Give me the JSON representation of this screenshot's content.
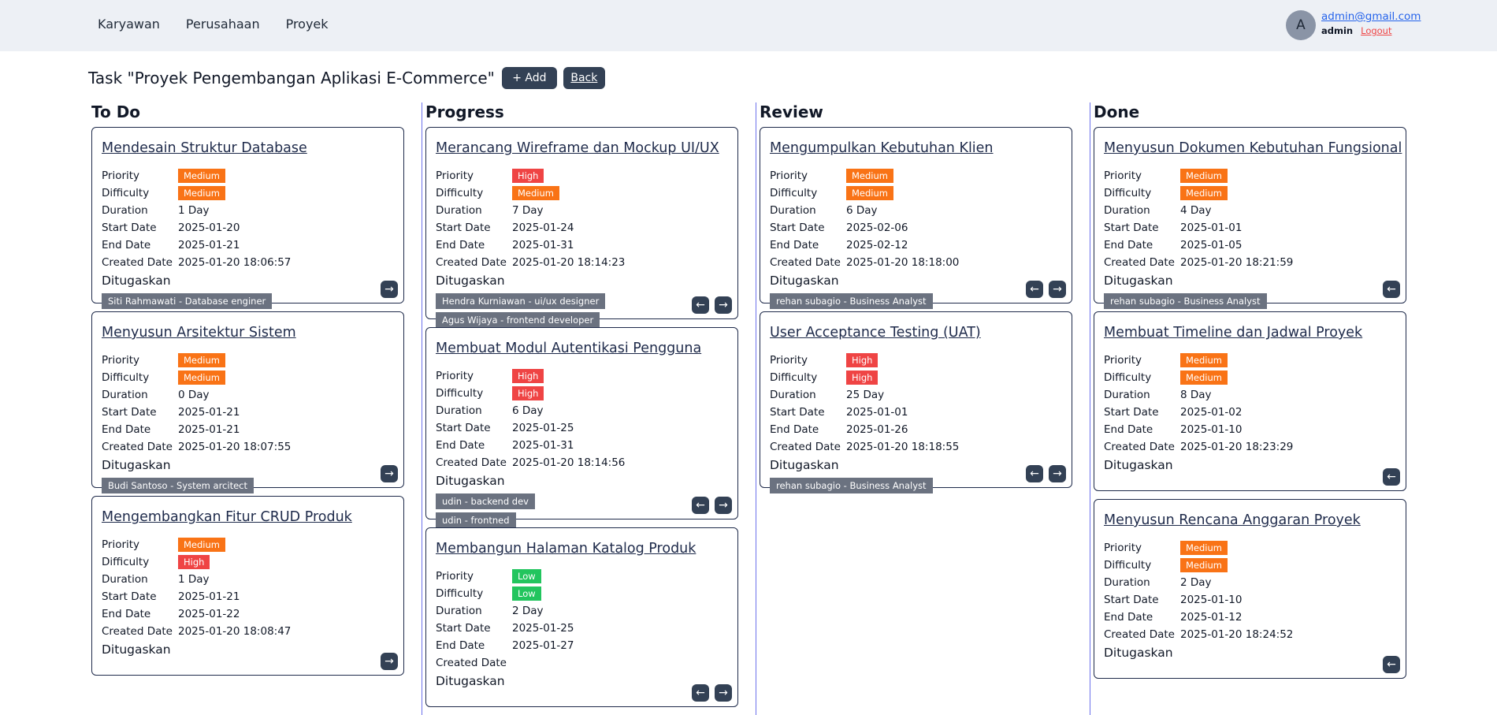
{
  "nav": {
    "links": [
      "Karyawan",
      "Perusahaan",
      "Proyek"
    ]
  },
  "user": {
    "avatar_letter": "A",
    "email": "admin@gmail.com",
    "role": "admin",
    "logout": "Logout"
  },
  "page": {
    "title": "Task \"Proyek Pengembangan Aplikasi E-Commerce\"",
    "add_label": "+ Add",
    "back_label": "Back"
  },
  "field_labels": {
    "priority": "Priority",
    "difficulty": "Difficulty",
    "duration": "Duration",
    "start": "Start Date",
    "end": "End Date",
    "created": "Created Date",
    "assigned": "Ditugaskan"
  },
  "icons": {
    "prev": "arrow-left-icon",
    "next": "arrow-right-icon"
  },
  "colors": {
    "medium": "#f97316",
    "high": "#ef4444",
    "low": "#22c55e",
    "chip": "#6b7280",
    "button": "#334155",
    "column_divider": "#6d72ec"
  },
  "columns": [
    {
      "title": "To Do",
      "cards": [
        {
          "title": "Mendesain Struktur Database",
          "priority": "Medium",
          "difficulty": "Medium",
          "duration": "1 Day",
          "start": "2025-01-20",
          "end": "2025-01-21",
          "created": "2025-01-20 18:06:57",
          "assignees": [
            "Siti Rahmawati - Database enginer"
          ],
          "prev": false,
          "next": true
        },
        {
          "title": "Menyusun Arsitektur Sistem",
          "priority": "Medium",
          "difficulty": "Medium",
          "duration": "0 Day",
          "start": "2025-01-21",
          "end": "2025-01-21",
          "created": "2025-01-20 18:07:55",
          "assignees": [
            "Budi Santoso - System arcitect"
          ],
          "prev": false,
          "next": true
        },
        {
          "title": "Mengembangkan Fitur CRUD Produk",
          "priority": "Medium",
          "difficulty": "High",
          "duration": "1 Day",
          "start": "2025-01-21",
          "end": "2025-01-22",
          "created": "2025-01-20 18:08:47",
          "assignees": [],
          "prev": false,
          "next": true
        }
      ]
    },
    {
      "title": "Progress",
      "cards": [
        {
          "title": "Merancang Wireframe dan Mockup UI/UX",
          "priority": "High",
          "difficulty": "Medium",
          "duration": "7 Day",
          "start": "2025-01-24",
          "end": "2025-01-31",
          "created": "2025-01-20 18:14:23",
          "assignees": [
            "Hendra Kurniawan - ui/ux designer",
            "Agus Wijaya - frontend developer"
          ],
          "prev": true,
          "next": true
        },
        {
          "title": "Membuat Modul Autentikasi Pengguna",
          "priority": "High",
          "difficulty": "High",
          "duration": "6 Day",
          "start": "2025-01-25",
          "end": "2025-01-31",
          "created": "2025-01-20 18:14:56",
          "assignees": [
            "udin - backend dev",
            "udin - frontned"
          ],
          "prev": true,
          "next": true
        },
        {
          "title": "Membangun Halaman Katalog Produk",
          "priority": "Low",
          "difficulty": "Low",
          "duration": "2 Day",
          "start": "2025-01-25",
          "end": "2025-01-27",
          "created": "",
          "assignees": [],
          "prev": true,
          "next": true
        }
      ]
    },
    {
      "title": "Review",
      "cards": [
        {
          "title": "Mengumpulkan Kebutuhan Klien",
          "priority": "Medium",
          "difficulty": "Medium",
          "duration": "6 Day",
          "start": "2025-02-06",
          "end": "2025-02-12",
          "created": "2025-01-20 18:18:00",
          "assignees": [
            "rehan subagio - Business Analyst"
          ],
          "prev": true,
          "next": true
        },
        {
          "title": "User Acceptance Testing (UAT)",
          "priority": "High",
          "difficulty": "High",
          "duration": "25 Day",
          "start": "2025-01-01",
          "end": "2025-01-26",
          "created": "2025-01-20 18:18:55",
          "assignees": [
            "rehan subagio - Business Analyst"
          ],
          "prev": true,
          "next": true
        }
      ]
    },
    {
      "title": "Done",
      "cards": [
        {
          "title": "Menyusun Dokumen Kebutuhan Fungsional",
          "priority": "Medium",
          "difficulty": "Medium",
          "duration": "4 Day",
          "start": "2025-01-01",
          "end": "2025-01-05",
          "created": "2025-01-20 18:21:59",
          "assignees": [
            "rehan subagio - Business Analyst"
          ],
          "prev": true,
          "next": false
        },
        {
          "title": "Membuat Timeline dan Jadwal Proyek",
          "priority": "Medium",
          "difficulty": "Medium",
          "duration": "8 Day",
          "start": "2025-01-02",
          "end": "2025-01-10",
          "created": "2025-01-20 18:23:29",
          "assignees": [],
          "prev": true,
          "next": false
        },
        {
          "title": "Menyusun Rencana Anggaran Proyek",
          "priority": "Medium",
          "difficulty": "Medium",
          "duration": "2 Day",
          "start": "2025-01-10",
          "end": "2025-01-12",
          "created": "2025-01-20 18:24:52",
          "assignees": [],
          "prev": true,
          "next": false
        }
      ]
    }
  ]
}
